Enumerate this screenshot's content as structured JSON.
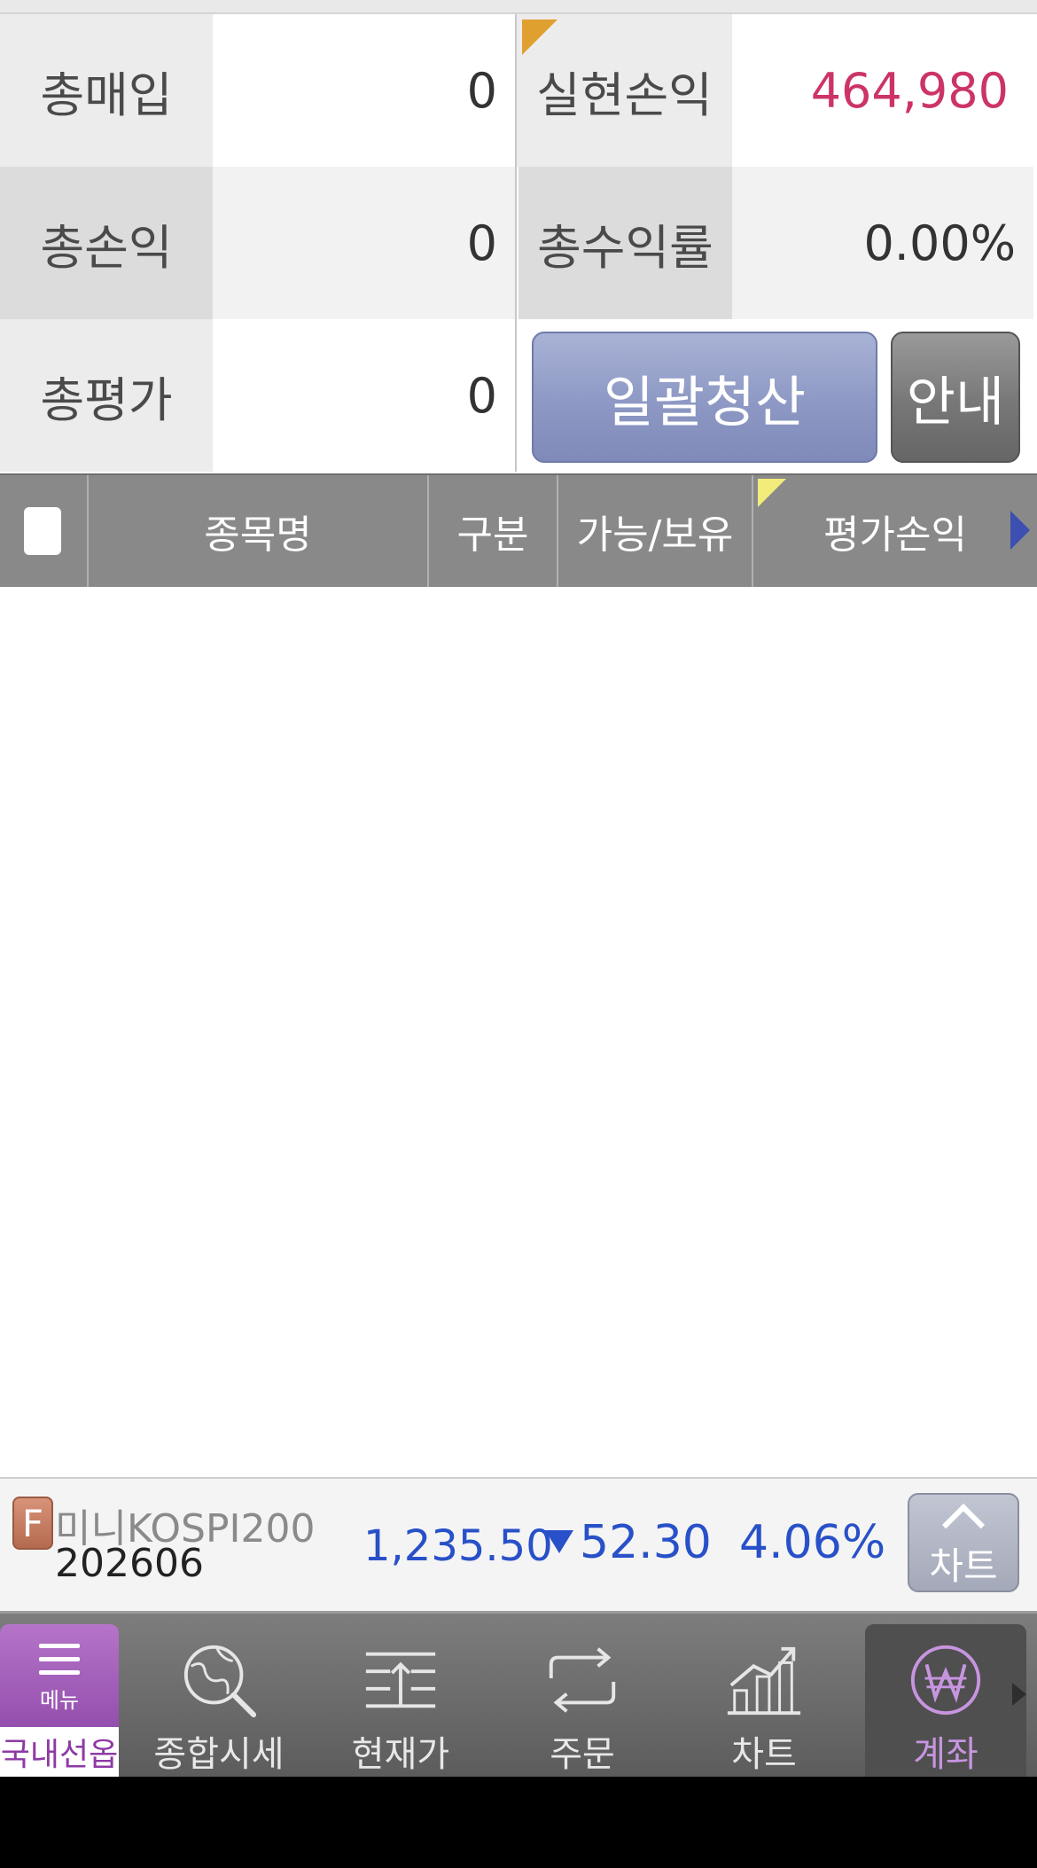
{
  "summary": {
    "total_purchase_label": "총매입",
    "total_purchase_value": "0",
    "realized_pl_label": "실현손익",
    "realized_pl_value": "464,980",
    "total_pl_label": "총손익",
    "total_pl_value": "0",
    "total_return_label": "총수익률",
    "total_return_value": "0.00%",
    "total_eval_label": "총평가",
    "total_eval_value": "0"
  },
  "buttons": {
    "bulk_liquidate": "일괄청산",
    "info": "안내"
  },
  "table": {
    "columns": [
      "종목명",
      "구분",
      "가능/보유",
      "평가손익"
    ]
  },
  "ticker": {
    "badge": "F",
    "name": "미니KOSPI200",
    "code": "202606",
    "price": "1,235.50",
    "change": "52.30",
    "change_pct": "4.06%",
    "chart_button": "차트"
  },
  "nav": {
    "menu_label": "메뉴",
    "menu_sub": "국내선옵",
    "items": [
      {
        "label": "종합시세",
        "icon": "globe-search-icon"
      },
      {
        "label": "현재가",
        "icon": "current-price-icon"
      },
      {
        "label": "주문",
        "icon": "order-exchange-icon"
      },
      {
        "label": "차트",
        "icon": "chart-icon"
      },
      {
        "label": "계좌",
        "icon": "won-icon"
      }
    ]
  },
  "colors": {
    "realized_pl": "#cc3466",
    "down": "#2850c8",
    "menu_purple": "#944fad",
    "active_nav": "#c795e0"
  }
}
